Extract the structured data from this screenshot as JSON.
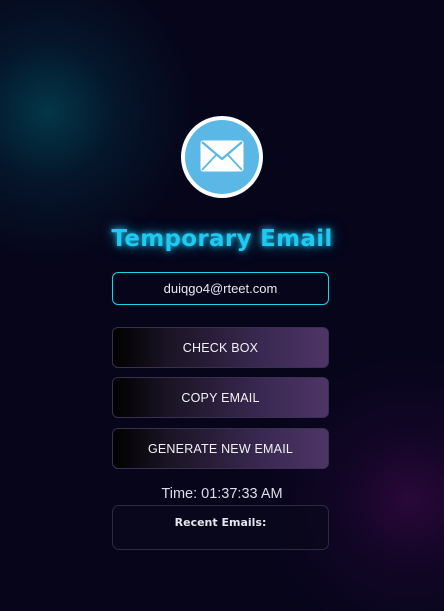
{
  "app": {
    "title": "Temporary Email",
    "logo_icon": "envelope-icon"
  },
  "email": {
    "value": "duiqgo4@rteet.com"
  },
  "buttons": {
    "check_box": "CHECK BOX",
    "copy_email": "COPY EMAIL",
    "generate_new_email": "GENERATE NEW EMAIL"
  },
  "time": {
    "text": "Time: 01:37:33 AM"
  },
  "recent": {
    "heading": "Recent Emails:",
    "items": []
  },
  "colors": {
    "background": "#06051a",
    "accent_cyan": "#1ec9f2",
    "logo_circle": "#5bb8e6",
    "button_gradient_end": "#4e3566"
  }
}
